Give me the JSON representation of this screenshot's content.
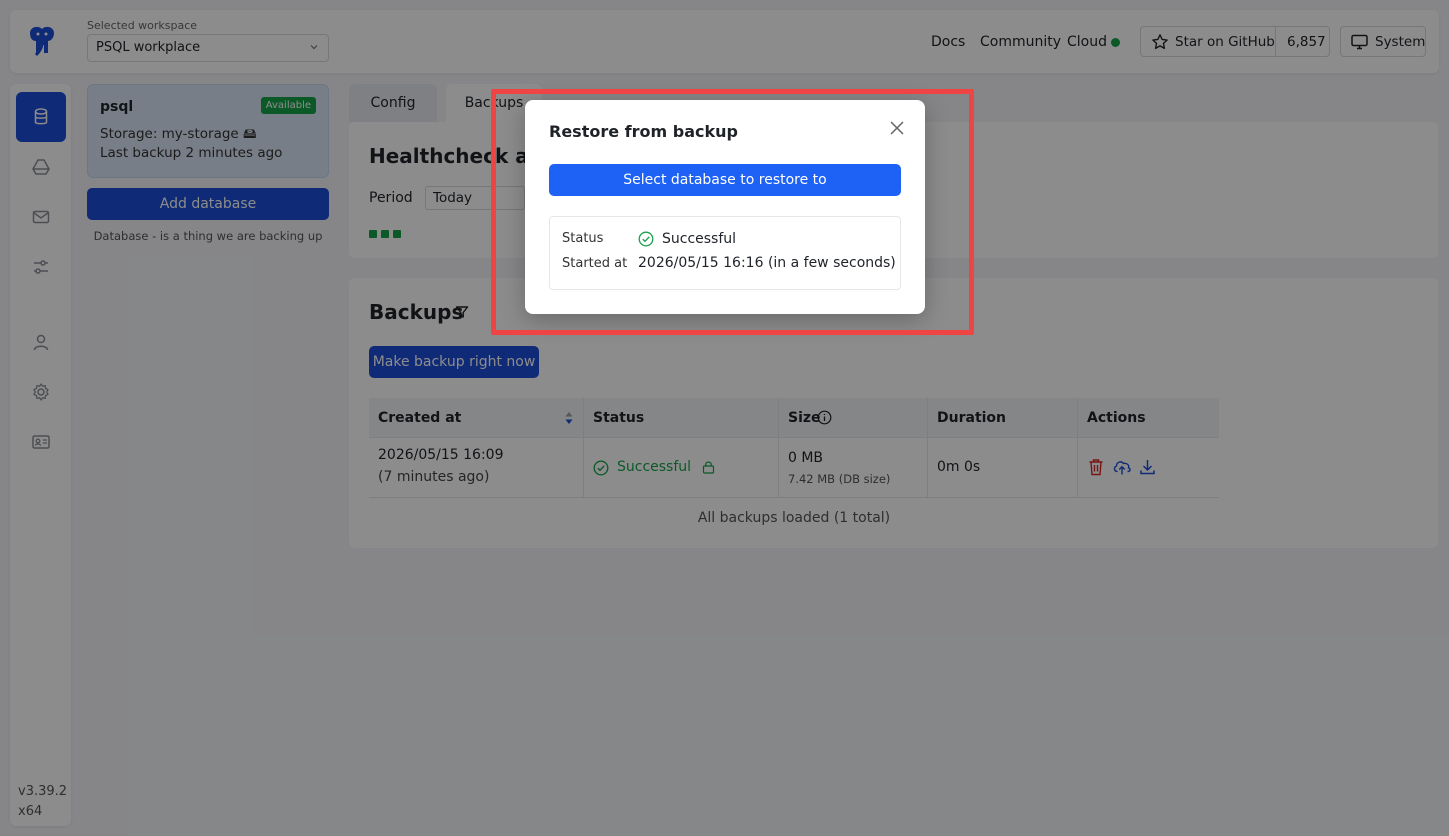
{
  "header": {
    "workspace_label": "Selected workspace",
    "workspace_value": "PSQL workplace",
    "links": {
      "docs": "Docs",
      "community": "Community",
      "cloud": "Cloud"
    },
    "star_label": "Star on GitHub",
    "star_count": "6,857",
    "system_label": "System"
  },
  "sidebar": {
    "items": [
      {
        "icon": "database-icon",
        "active": true
      },
      {
        "icon": "drive-icon"
      },
      {
        "icon": "mail-icon"
      },
      {
        "icon": "sliders-icon"
      },
      {
        "icon": "user-icon"
      },
      {
        "icon": "gear-icon"
      },
      {
        "icon": "id-card-icon"
      }
    ],
    "version": "v3.39.2",
    "arch": "x64"
  },
  "databases": {
    "card": {
      "name": "psql",
      "badge": "Available",
      "storage": "Storage: my-storage 🖴",
      "last_backup": "Last backup 2 minutes ago"
    },
    "add_button": "Add database",
    "hint": "Database - is a thing we are backing up"
  },
  "tabs": {
    "config": "Config",
    "backups": "Backups"
  },
  "healthcheck": {
    "title": "Healthcheck atte",
    "period_label": "Period",
    "period_value": "Today"
  },
  "backups": {
    "title": "Backups",
    "make_button": "Make backup right now",
    "columns": {
      "created": "Created at",
      "status": "Status",
      "size": "Size",
      "duration": "Duration",
      "actions": "Actions"
    },
    "row": {
      "created": "2026/05/15 16:09",
      "created_rel": "(7 minutes ago)",
      "status": "Successful",
      "size": "0 MB",
      "db_size": "7.42 MB (DB size)",
      "duration": "0m 0s"
    },
    "footer": "All backups loaded (1 total)"
  },
  "modal": {
    "title": "Restore from backup",
    "button": "Select database to restore to",
    "status_label": "Status",
    "status_value": "Successful",
    "started_label": "Started at",
    "started_value": "2026/05/15 16:16 (in a few seconds)"
  },
  "colors": {
    "primary": "#1d4ed8",
    "success": "#17a34a",
    "highlight": "#ef4444"
  }
}
